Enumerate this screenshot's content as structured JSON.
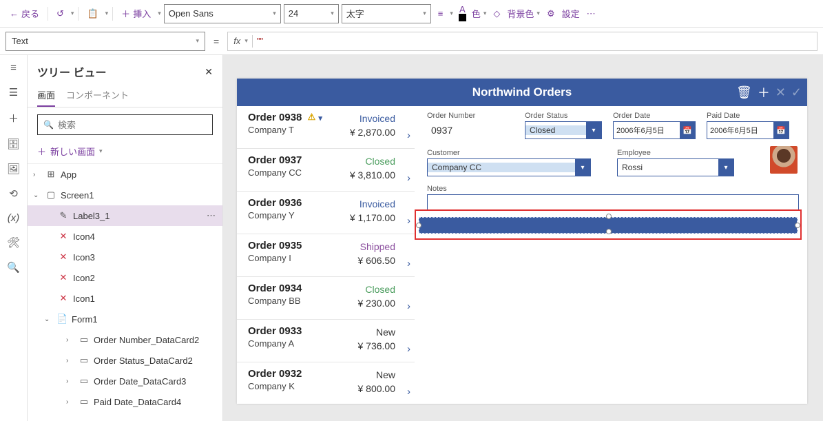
{
  "toolbar": {
    "back": "戻る",
    "insert": "挿入",
    "font": "Open Sans",
    "font_size": "24",
    "weight": "太字",
    "color_label": "色",
    "bgcolor": "背景色",
    "settings": "設定"
  },
  "formula": {
    "property": "Text",
    "fx": "fx",
    "value": "\"\""
  },
  "tree": {
    "title": "ツリー ビュー",
    "tab_screens": "画面",
    "tab_components": "コンポーネント",
    "search_placeholder": "検索",
    "new_screen": "新しい画面",
    "nodes": {
      "app": "App",
      "screen1": "Screen1",
      "label3_1": "Label3_1",
      "icon4": "Icon4",
      "icon3": "Icon3",
      "icon2": "Icon2",
      "icon1": "Icon1",
      "form1": "Form1",
      "dc_ordernum": "Order Number_DataCard2",
      "dc_status": "Order Status_DataCard2",
      "dc_orderdate": "Order Date_DataCard3",
      "dc_paiddate": "Paid Date_DataCard4"
    }
  },
  "app": {
    "title": "Northwind Orders",
    "gallery": [
      {
        "title": "Order 0938",
        "sub": "Company T",
        "status": "Invoiced",
        "status_cls": "st-inv",
        "price": "¥ 2,870.00",
        "warn": true
      },
      {
        "title": "Order 0937",
        "sub": "Company CC",
        "status": "Closed",
        "status_cls": "st-closed",
        "price": "¥ 3,810.00",
        "warn": false
      },
      {
        "title": "Order 0936",
        "sub": "Company Y",
        "status": "Invoiced",
        "status_cls": "st-inv",
        "price": "¥ 1,170.00",
        "warn": false
      },
      {
        "title": "Order 0935",
        "sub": "Company I",
        "status": "Shipped",
        "status_cls": "st-shipped",
        "price": "¥ 606.50",
        "warn": false
      },
      {
        "title": "Order 0934",
        "sub": "Company BB",
        "status": "Closed",
        "status_cls": "st-closed",
        "price": "¥ 230.00",
        "warn": false
      },
      {
        "title": "Order 0933",
        "sub": "Company A",
        "status": "New",
        "status_cls": "st-new",
        "price": "¥ 736.00",
        "warn": false
      },
      {
        "title": "Order 0932",
        "sub": "Company K",
        "status": "New",
        "status_cls": "st-new",
        "price": "¥ 800.00",
        "warn": false
      }
    ],
    "form": {
      "order_number_lbl": "Order Number",
      "order_number": "0937",
      "order_status_lbl": "Order Status",
      "order_status": "Closed",
      "order_date_lbl": "Order Date",
      "order_date": "2006年6月5日",
      "paid_date_lbl": "Paid Date",
      "paid_date": "2006年6月5日",
      "customer_lbl": "Customer",
      "customer": "Company CC",
      "employee_lbl": "Employee",
      "employee": "Rossi",
      "notes_lbl": "Notes"
    }
  }
}
